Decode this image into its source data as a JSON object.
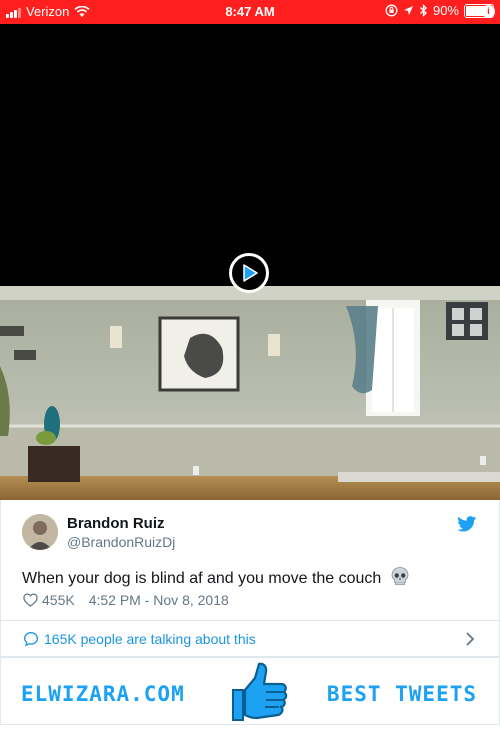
{
  "status_bar": {
    "carrier": "Verizon",
    "time": "8:47 AM",
    "battery": "90%",
    "battery_level": 0.9,
    "icons": [
      "signal-icon",
      "wifi-icon",
      "lock-rotation-icon",
      "location-icon",
      "bluetooth-icon",
      "battery-icon"
    ]
  },
  "video": {
    "play_icon": "play-icon"
  },
  "tweet": {
    "author_name": "Brandon Ruiz",
    "author_handle": "@BrandonRuizDj",
    "text": "When your dog is blind af and you move the couch",
    "emoji": "skull-icon",
    "likes": "455K",
    "timestamp": "4:52 PM - Nov 8, 2018"
  },
  "conversation": {
    "label": "165K people are talking about this"
  },
  "branding": {
    "site": "ELWIZARA.COM",
    "tagline": "BEST TWEETS"
  },
  "colors": {
    "status_bar": "#ff1f1f",
    "twitter_blue": "#1da1f2",
    "link_blue": "#1b95e0",
    "muted_text": "#657786"
  }
}
